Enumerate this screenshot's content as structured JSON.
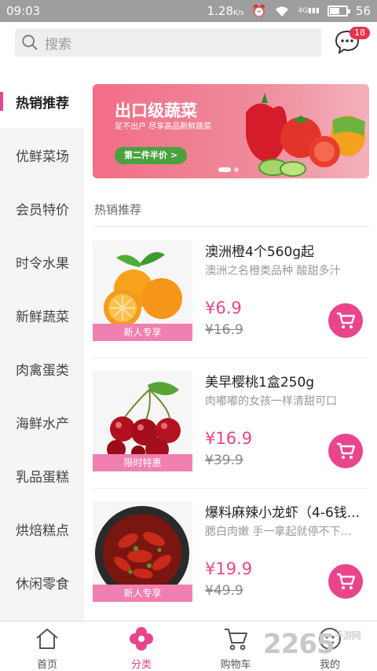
{
  "status_bar": {
    "time": "09:03",
    "network_speed": "1.28",
    "signal_type": "4G",
    "battery": "56",
    "icons": [
      "network-speed-icon",
      "alarm-icon",
      "wifi-icon",
      "signal-icon",
      "battery-icon"
    ]
  },
  "header": {
    "search_placeholder": "搜索",
    "message_badge": "18"
  },
  "sidebar": {
    "items": [
      {
        "label": "热销推荐",
        "active": true
      },
      {
        "label": "优鲜菜场",
        "active": false
      },
      {
        "label": "会员特价",
        "active": false
      },
      {
        "label": "时令水果",
        "active": false
      },
      {
        "label": "新鲜蔬菜",
        "active": false
      },
      {
        "label": "肉禽蛋类",
        "active": false
      },
      {
        "label": "海鲜水产",
        "active": false
      },
      {
        "label": "乳品蛋糕",
        "active": false
      },
      {
        "label": "烘焙糕点",
        "active": false
      },
      {
        "label": "休闲零食",
        "active": false
      }
    ]
  },
  "banner": {
    "title": "出口级蔬菜",
    "subtitle": "足不出户 尽享高品新鲜蔬菜",
    "button": "第二件半价 >",
    "slides": 2,
    "active_slide": 1
  },
  "section_title": "热销推荐",
  "products": [
    {
      "name": "澳洲橙4个560g起",
      "desc": "澳洲之名橙类品种 酸甜多汁",
      "price": "¥6.9",
      "old_price": "¥16.9",
      "tag": "新人专享",
      "image": "oranges"
    },
    {
      "name": "美早樱桃1盒250g",
      "desc": "肉嘟嘟的女孩一样清甜可口",
      "price": "¥16.9",
      "old_price": "¥39.9",
      "tag": "限时特惠",
      "image": "cherries"
    },
    {
      "name": "爆料麻辣小龙虾（4-6钱...",
      "desc": "腮白肉嫩 手一拿起就停不下...",
      "price": "¥19.9",
      "old_price": "¥49.9",
      "tag": "新人专享",
      "image": "crayfish"
    }
  ],
  "tabbar": {
    "tabs": [
      {
        "label": "首页",
        "icon": "home-icon",
        "active": false
      },
      {
        "label": "分类",
        "icon": "category-flower-icon",
        "active": true
      },
      {
        "label": "购物车",
        "icon": "cart-icon",
        "active": false
      },
      {
        "label": "我的",
        "icon": "profile-icon",
        "active": false
      }
    ]
  },
  "watermark": {
    "main": "2265",
    "sub": "手游网"
  },
  "colors": {
    "accent": "#e8458c",
    "badge": "#e8334a",
    "banner_button": "#4aa23e"
  }
}
